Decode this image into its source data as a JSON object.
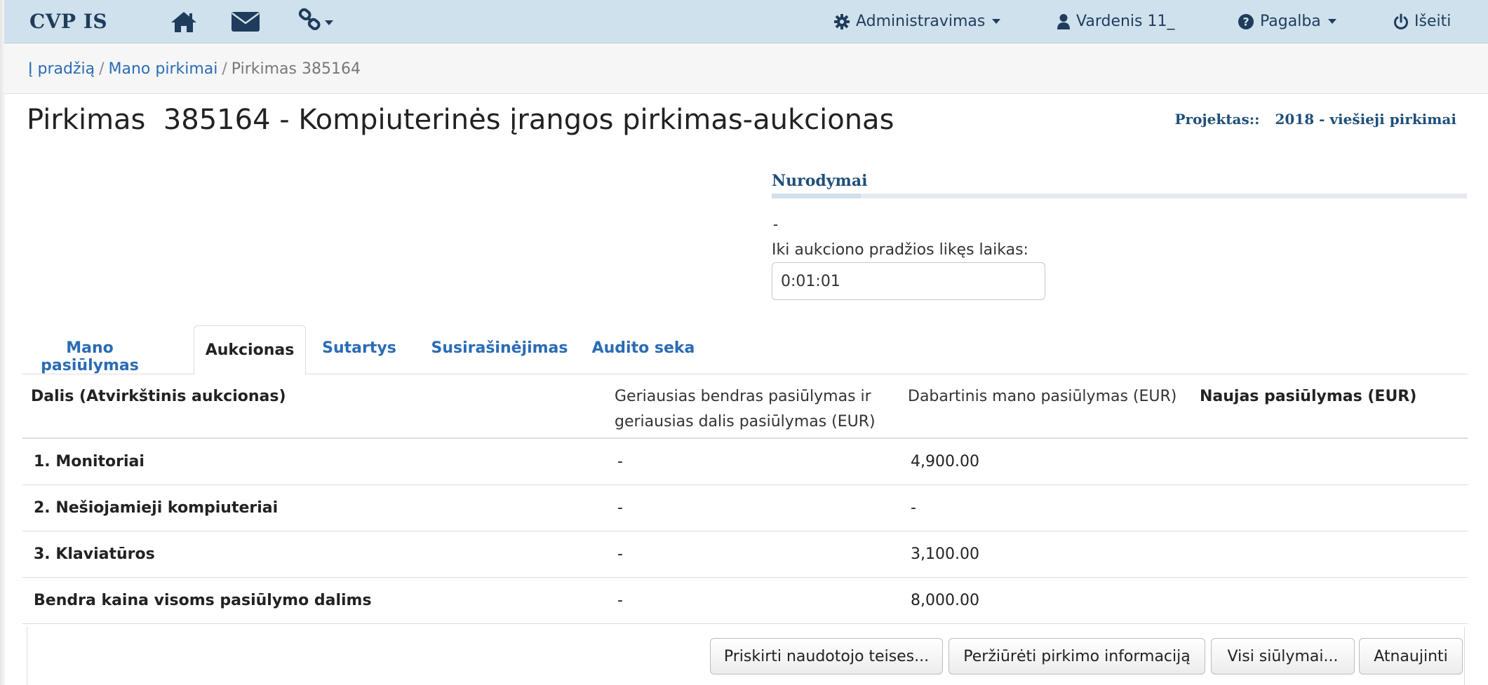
{
  "navbar": {
    "brand": "CVP IS",
    "admin_label": "Administravimas",
    "user_label": "Vardenis 11_",
    "help_label": "Pagalba",
    "logout_label": "Išeiti"
  },
  "breadcrumb": {
    "home": "Į pradžią",
    "my_purchases": "Mano pirkimai",
    "current": "Pirkimas 385164"
  },
  "page": {
    "title": "Pirkimas  385164 - Kompiuterinės įrangos pirkimas-aukcionas",
    "project_label": "Projektas::",
    "project_value": "2018 - viešieji pirkimai"
  },
  "instructions": {
    "title": "Nurodymai",
    "dash": "-",
    "countdown_label": "Iki aukciono pradžios likęs laikas:",
    "countdown_value": "0:01:01"
  },
  "tabs": [
    {
      "label": "Mano pasiūlymas"
    },
    {
      "label": "Aukcionas",
      "active": true
    },
    {
      "label": "Sutartys"
    },
    {
      "label": "Susirašinėjimas"
    },
    {
      "label": "Audito seka"
    }
  ],
  "table": {
    "headers": {
      "part": "Dalis   (Atvirkštinis aukcionas)",
      "best_line1": "Geriausias bendras pasiūlymas ir",
      "best_line2": "geriausias dalis pasiūlymas (EUR)",
      "current": "Dabartinis mano pasiūlymas (EUR)",
      "new": "Naujas pasiūlymas (EUR)"
    },
    "rows": [
      {
        "part": "1. Monitoriai",
        "best": "-",
        "current": "4,900.00",
        "new": ""
      },
      {
        "part": "2. Nešiojamieji kompiuteriai",
        "best": "-",
        "current": "-",
        "new": ""
      },
      {
        "part": "3. Klaviatūros",
        "best": "-",
        "current": "3,100.00",
        "new": ""
      },
      {
        "part": "Bendra kaina visoms pasiūlymo dalims",
        "best": "-",
        "current": "8,000.00",
        "new": ""
      }
    ]
  },
  "buttons": {
    "assign_rights": "Priskirti naudotojo teises...",
    "view_info": "Peržiūrėti pirkimo informaciją",
    "all_offers": "Visi siūlymai...",
    "refresh": "Atnaujinti"
  },
  "colors": {
    "navbar_bg": "#cfe1ec",
    "brand_text": "#1f3c5c",
    "link": "#2a6cb5"
  }
}
